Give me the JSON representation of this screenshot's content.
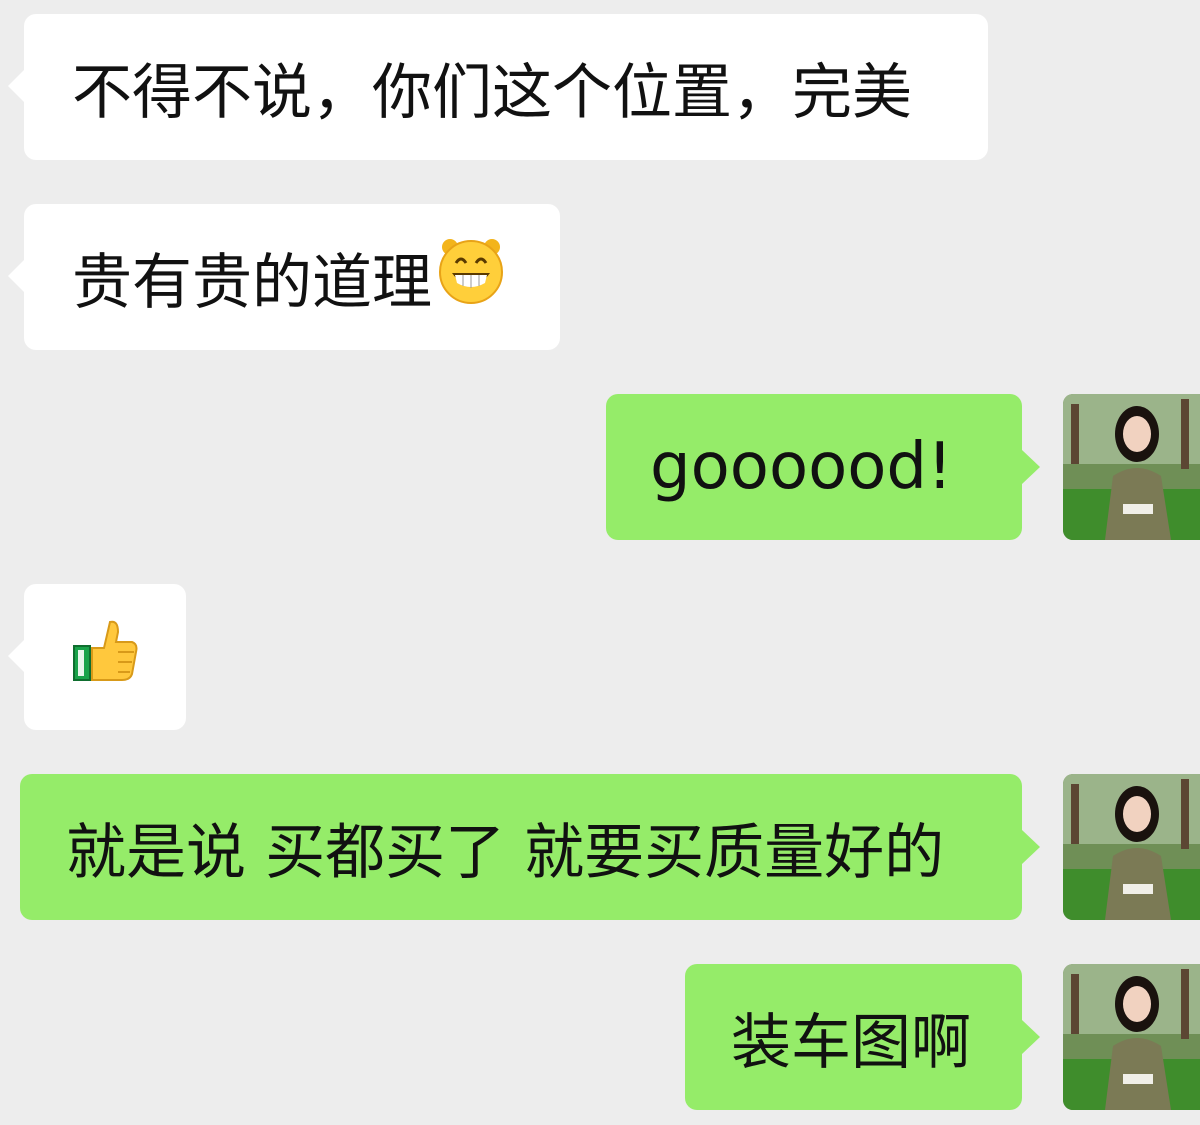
{
  "messages": [
    {
      "side": "in",
      "text": "不得不说，你们这个位置，完美"
    },
    {
      "side": "in",
      "text": "贵有贵的道理",
      "emoji": "grinning-face-emoji"
    },
    {
      "side": "out",
      "text": "goooood!"
    },
    {
      "side": "in",
      "text": "",
      "emoji": "thumbs-up-emoji"
    },
    {
      "side": "out",
      "text": "就是说 买都买了 就要买质量好的"
    },
    {
      "side": "out",
      "text": "装车图啊"
    }
  ],
  "colors": {
    "background": "#ededed",
    "incoming_bubble": "#ffffff",
    "outgoing_bubble": "#95ec69"
  }
}
